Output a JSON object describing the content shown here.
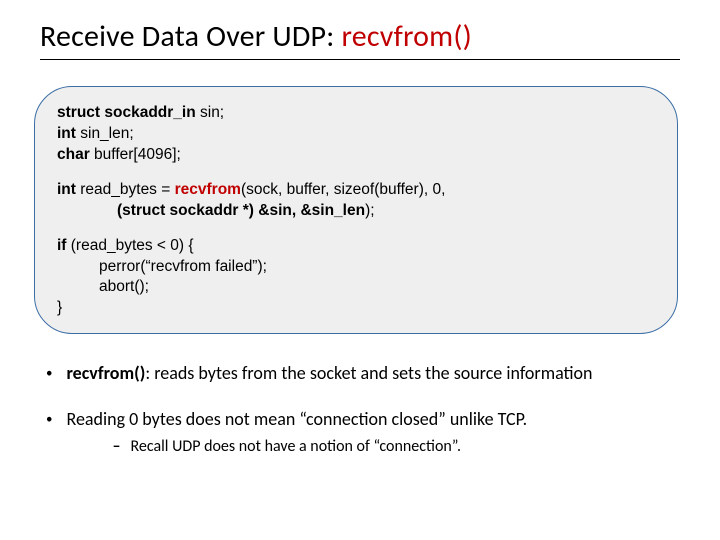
{
  "title": {
    "prefix": "Receive Data Over UDP: ",
    "func": "recvfrom()"
  },
  "code": {
    "l1a": "struct sockaddr_in",
    "l1b": " sin;",
    "l2a": "int",
    "l2b": " sin_len;",
    "l3a": "char",
    "l3b": " buffer[4096];",
    "l4a": "int",
    "l4b": " read_bytes = ",
    "l4c": "recvfrom",
    "l4d": "(sock, buffer, sizeof(buffer), 0,",
    "l5": "(struct sockaddr *) &sin, &sin_len",
    "l5end": ");",
    "l6a": "if",
    "l6b": " (read_bytes < 0) {",
    "l7": "perror(“recvfrom failed”);",
    "l8": "abort();",
    "l9": "}"
  },
  "bullets": {
    "b1_strong": "recvfrom()",
    "b1_rest": ": reads bytes from the socket and sets the source information",
    "b2": "Reading 0 bytes does not mean “connection closed” unlike TCP.",
    "b2_sub": "Recall UDP does not have a notion of “connection”."
  }
}
